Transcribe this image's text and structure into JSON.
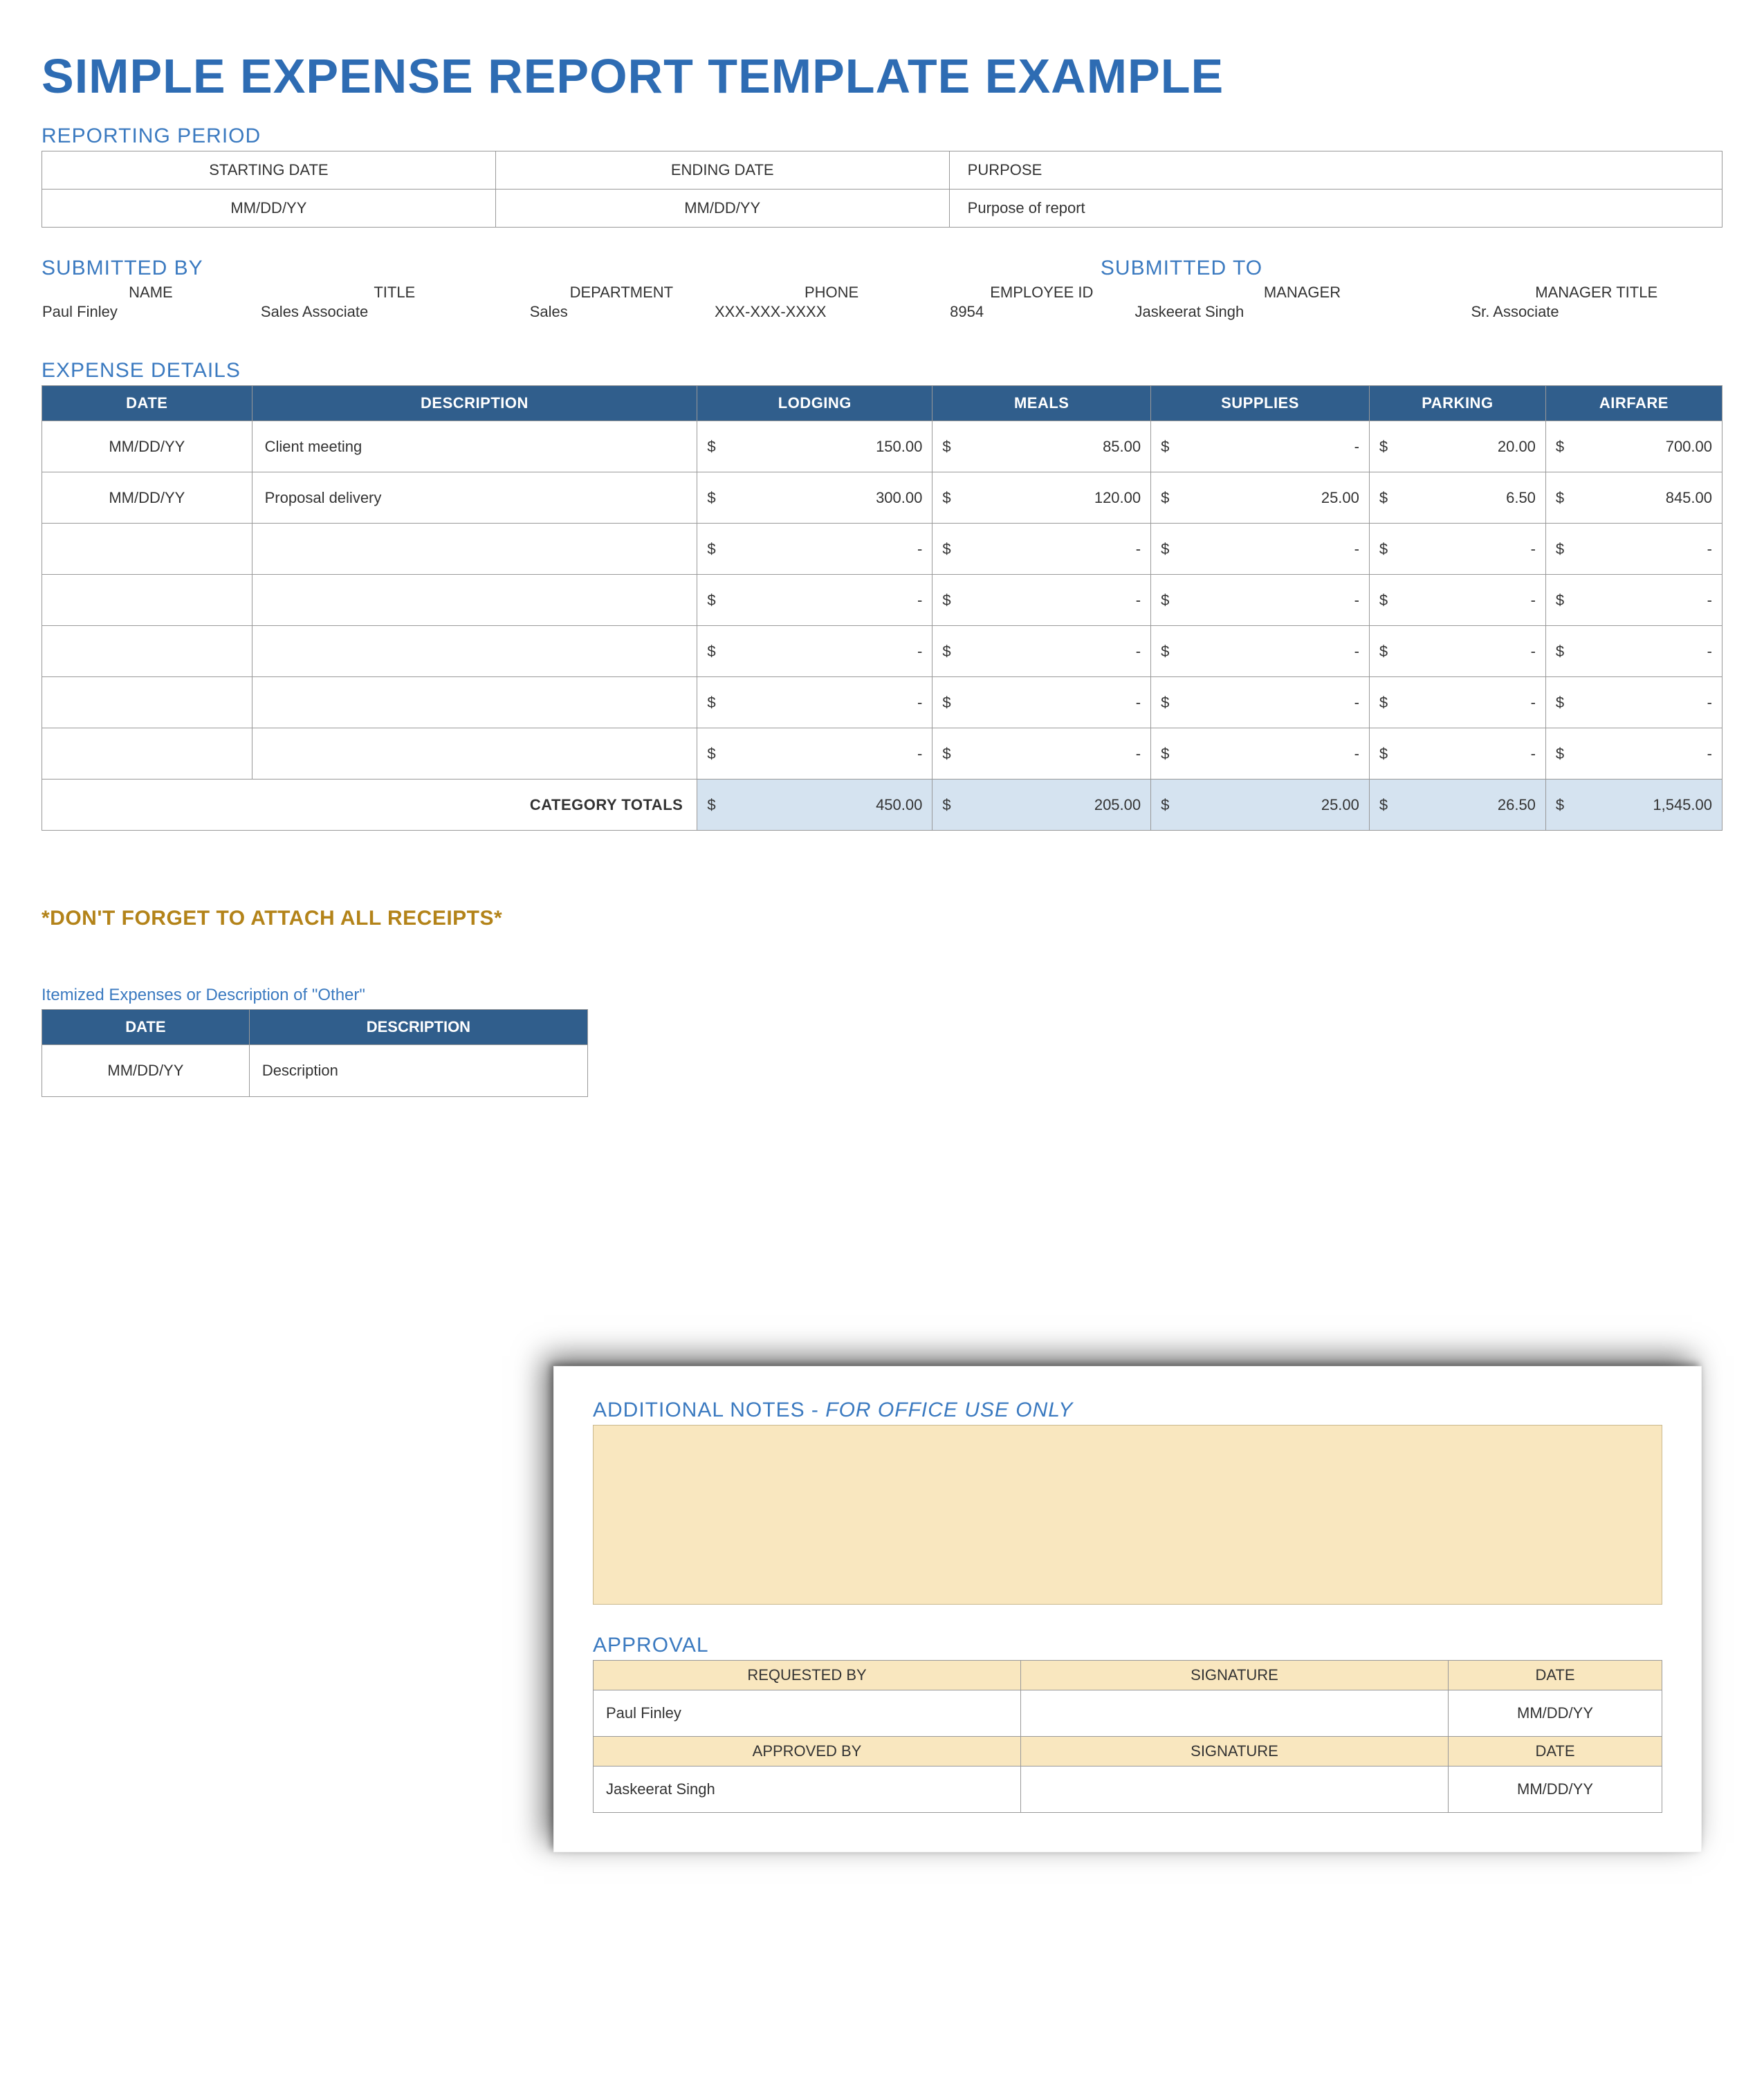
{
  "title": "SIMPLE EXPENSE REPORT TEMPLATE EXAMPLE",
  "reporting": {
    "label": "REPORTING PERIOD",
    "headers": {
      "start": "STARTING DATE",
      "end": "ENDING DATE",
      "purpose": "PURPOSE"
    },
    "values": {
      "start": "MM/DD/YY",
      "end": "MM/DD/YY",
      "purpose": "Purpose of report"
    }
  },
  "submitted": {
    "by_label": "SUBMITTED BY",
    "to_label": "SUBMITTED TO",
    "headers": {
      "name": "NAME",
      "title": "TITLE",
      "dept": "DEPARTMENT",
      "phone": "PHONE",
      "emp_id": "EMPLOYEE ID",
      "manager": "MANAGER",
      "mgr_title": "MANAGER TITLE"
    },
    "values": {
      "name": "Paul Finley",
      "title": "Sales Associate",
      "dept": "Sales",
      "phone": "XXX-XXX-XXXX",
      "emp_id": "8954",
      "manager": "Jaskeerat Singh",
      "mgr_title": "Sr. Associate"
    }
  },
  "expenses": {
    "label": "EXPENSE DETAILS",
    "columns": [
      "DATE",
      "DESCRIPTION",
      "LODGING",
      "MEALS",
      "SUPPLIES",
      "PARKING",
      "AIRFARE"
    ],
    "currency": "$",
    "rows": [
      {
        "date": "MM/DD/YY",
        "desc": "Client meeting",
        "lodging": "150.00",
        "meals": "85.00",
        "supplies": "-",
        "parking": "20.00",
        "airfare": "700.00"
      },
      {
        "date": "MM/DD/YY",
        "desc": "Proposal delivery",
        "lodging": "300.00",
        "meals": "120.00",
        "supplies": "25.00",
        "parking": "6.50",
        "airfare": "845.00"
      },
      {
        "date": "",
        "desc": "",
        "lodging": "-",
        "meals": "-",
        "supplies": "-",
        "parking": "-",
        "airfare": "-"
      },
      {
        "date": "",
        "desc": "",
        "lodging": "-",
        "meals": "-",
        "supplies": "-",
        "parking": "-",
        "airfare": "-"
      },
      {
        "date": "",
        "desc": "",
        "lodging": "-",
        "meals": "-",
        "supplies": "-",
        "parking": "-",
        "airfare": "-"
      },
      {
        "date": "",
        "desc": "",
        "lodging": "-",
        "meals": "-",
        "supplies": "-",
        "parking": "-",
        "airfare": "-"
      },
      {
        "date": "",
        "desc": "",
        "lodging": "-",
        "meals": "-",
        "supplies": "-",
        "parking": "-",
        "airfare": "-"
      }
    ],
    "totals_label": "CATEGORY TOTALS",
    "totals": {
      "lodging": "450.00",
      "meals": "205.00",
      "supplies": "25.00",
      "parking": "26.50",
      "airfare": "1,545.00"
    }
  },
  "attach_note": "*DON'T FORGET TO ATTACH ALL RECEIPTS*",
  "itemized": {
    "caption": "Itemized Expenses or Description of \"Other\"",
    "columns": [
      "DATE",
      "DESCRIPTION"
    ],
    "row": {
      "date": "MM/DD/YY",
      "desc": "Description"
    }
  },
  "notes": {
    "label_a": "ADDITIONAL NOTES - ",
    "label_b": "FOR OFFICE USE ONLY"
  },
  "approval": {
    "label": "APPROVAL",
    "headers": {
      "requested": "REQUESTED BY",
      "approved": "APPROVED BY",
      "signature": "SIGNATURE",
      "date": "DATE"
    },
    "requested_by": "Paul Finley",
    "requested_date": "MM/DD/YY",
    "approved_by": "Jaskeerat Singh",
    "approved_date": "MM/DD/YY"
  }
}
